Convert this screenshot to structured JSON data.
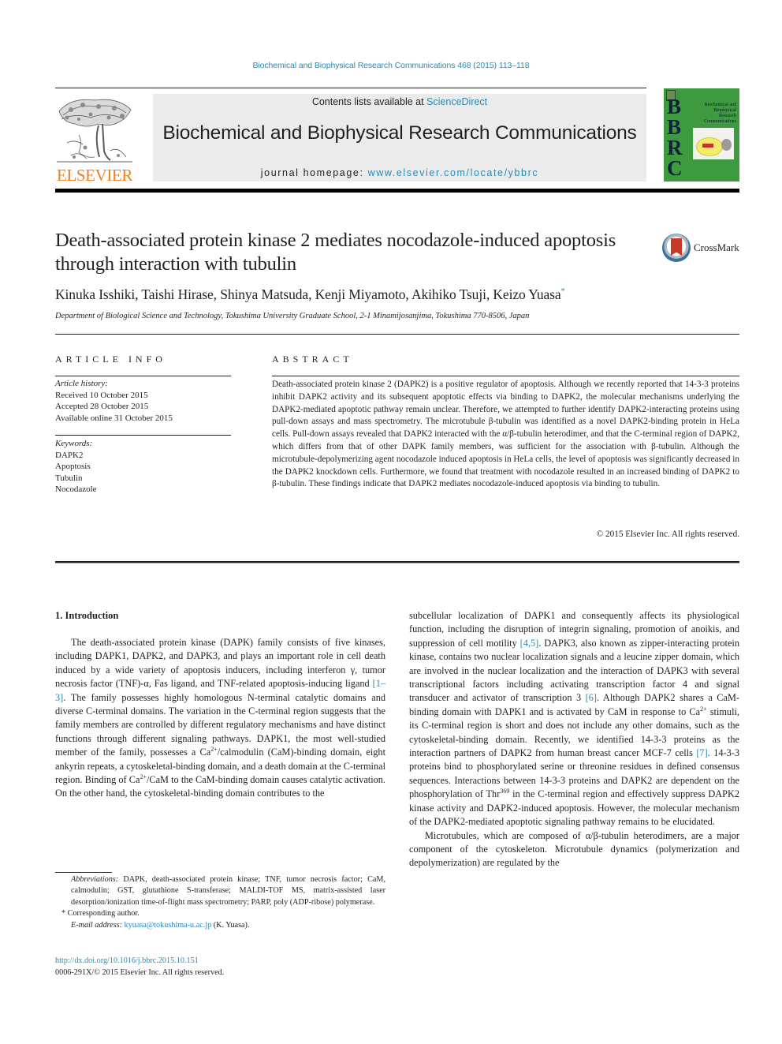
{
  "header": {
    "citation": "Biochemical and Biophysical Research Communications 468 (2015) 113–118",
    "contents_prefix": "Contents lists available at ",
    "contents_link": "ScienceDirect",
    "journal_title": "Biochemical and Biophysical Research Communications",
    "homepage_prefix": "journal homepage: ",
    "homepage_link": "www.elsevier.com/locate/ybbrc",
    "publisher_logo_text": "ELSEVIER",
    "cover": {
      "letters": [
        "B",
        "B",
        "R",
        "C"
      ],
      "title_lines": [
        "Biochemical and",
        "Biophysical",
        "Research",
        "Communications"
      ],
      "color": "#3e9a3e"
    },
    "publisher_color": "#f07d1b",
    "link_color": "#2a8ab5"
  },
  "article": {
    "title": "Death-associated protein kinase 2 mediates nocodazole-induced apoptosis through interaction with tubulin",
    "crossmark_label": "CrossMark",
    "authors": "Kinuka Isshiki, Taishi Hirase, Shinya Matsuda, Kenji Miyamoto, Akihiko Tsuji, Keizo Yuasa",
    "corresponding_mark": "*",
    "affiliation": "Department of Biological Science and Technology, Tokushima University Graduate School, 2-1 Minamijosanjima, Tokushima 770-8506, Japan"
  },
  "article_info": {
    "heading": "ARTICLE INFO",
    "history_label": "Article history:",
    "history": [
      "Received 10 October 2015",
      "Accepted 28 October 2015",
      "Available online 31 October 2015"
    ],
    "keywords_label": "Keywords:",
    "keywords": [
      "DAPK2",
      "Apoptosis",
      "Tubulin",
      "Nocodazole"
    ]
  },
  "abstract": {
    "heading": "ABSTRACT",
    "text": "Death-associated protein kinase 2 (DAPK2) is a positive regulator of apoptosis. Although we recently reported that 14-3-3 proteins inhibit DAPK2 activity and its subsequent apoptotic effects via binding to DAPK2, the molecular mechanisms underlying the DAPK2-mediated apoptotic pathway remain unclear. Therefore, we attempted to further identify DAPK2-interacting proteins using pull-down assays and mass spectrometry. The microtubule β-tubulin was identified as a novel DAPK2-binding protein in HeLa cells. Pull-down assays revealed that DAPK2 interacted with the α/β-tubulin heterodimer, and that the C-terminal region of DAPK2, which differs from that of other DAPK family members, was sufficient for the association with β-tubulin. Although the microtubule-depolymerizing agent nocodazole induced apoptosis in HeLa cells, the level of apoptosis was significantly decreased in the DAPK2 knockdown cells. Furthermore, we found that treatment with nocodazole resulted in an increased binding of DAPK2 to β-tubulin. These findings indicate that DAPK2 mediates nocodazole-induced apoptosis via binding to tubulin.",
    "copyright": "© 2015 Elsevier Inc. All rights reserved."
  },
  "introduction": {
    "heading": "1.  Introduction",
    "left": {
      "p1_a": "The death-associated protein kinase (DAPK) family consists of five kinases, including DAPK1, DAPK2, and DAPK3, and plays an important role in cell death induced by a wide variety of apoptosis inducers, including interferon γ, tumor necrosis factor (TNF)-α, Fas ligand, and TNF-related apoptosis-inducing ligand ",
      "ref1": "[1–3]",
      "p1_b": ". The family possesses highly homologous N-terminal catalytic domains and diverse C-terminal domains. The variation in the C-terminal region suggests that the family members are controlled by different regulatory mechanisms and have distinct functions through different signaling pathways. DAPK1, the most well-studied member of the family, possesses a Ca",
      "sup1": "2+",
      "p1_c": "/calmodulin (CaM)-binding domain, eight ankyrin repeats, a cytoskeletal-binding domain, and a death domain at the C-terminal region. Binding of Ca",
      "sup2": "2+",
      "p1_d": "/CaM to the CaM-binding domain causes catalytic activation. On the other hand, the cytoskeletal-binding domain contributes to the"
    },
    "right": {
      "p1_a": "subcellular localization of DAPK1 and consequently affects its physiological function, including the disruption of integrin signaling, promotion of anoikis, and suppression of cell motility ",
      "ref2": "[4,5]",
      "p1_b": ". DAPK3, also known as zipper-interacting protein kinase, contains two nuclear localization signals and a leucine zipper domain, which are involved in the nuclear localization and the interaction of DAPK3 with several transcriptional factors including activating transcription factor 4 and signal transducer and activator of transcription 3 ",
      "ref3": "[6]",
      "p1_c": ". Although DAPK2 shares a CaM-binding domain with DAPK1 and is activated by CaM in response to Ca",
      "sup1": "2+",
      "p1_d": " stimuli, its C-terminal region is short and does not include any other domains, such as the cytoskeletal-binding domain. Recently, we identified 14-3-3 proteins as the interaction partners of DAPK2 from human breast cancer MCF-7 cells ",
      "ref4": "[7]",
      "p1_e": ". 14-3-3 proteins bind to phosphorylated serine or threonine residues in defined consensus sequences. Interactions between 14-3-3 proteins and DAPK2 are dependent on the phosphorylation of Thr",
      "sup2": "369",
      "p1_f": " in the C-terminal region and effectively suppress DAPK2 kinase activity and DAPK2-induced apoptosis. However, the molecular mechanism of the DAPK2-mediated apoptotic signaling pathway remains to be elucidated.",
      "p2": "Microtubules, which are composed of α/β-tubulin heterodimers, are a major component of the cytoskeleton. Microtubule dynamics (polymerization and depolymerization) are regulated by the"
    }
  },
  "footnotes": {
    "abbrev_label": "Abbreviations:",
    "abbrev_text": " DAPK, death-associated protein kinase; TNF, tumor necrosis factor; CaM, calmodulin; GST, glutathione S-transferase; MALDI-TOF MS, matrix-assisted laser desorption/ionization time-of-flight mass spectrometry; PARP, poly (ADP-ribose) polymerase.",
    "corresponding": "* Corresponding author.",
    "email_label": "E-mail address:",
    "email": "kyuasa@tokushima-u.ac.jp",
    "email_suffix": " (K. Yuasa).",
    "doi": "http://dx.doi.org/10.1016/j.bbrc.2015.10.151",
    "issn": "0006-291X/© 2015 Elsevier Inc. All rights reserved."
  }
}
